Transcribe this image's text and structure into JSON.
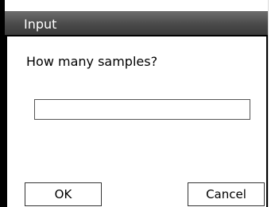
{
  "dialog": {
    "title": "Input",
    "prompt": "How many samples?",
    "input_value": "",
    "ok_label": "OK",
    "cancel_label": "Cancel"
  }
}
